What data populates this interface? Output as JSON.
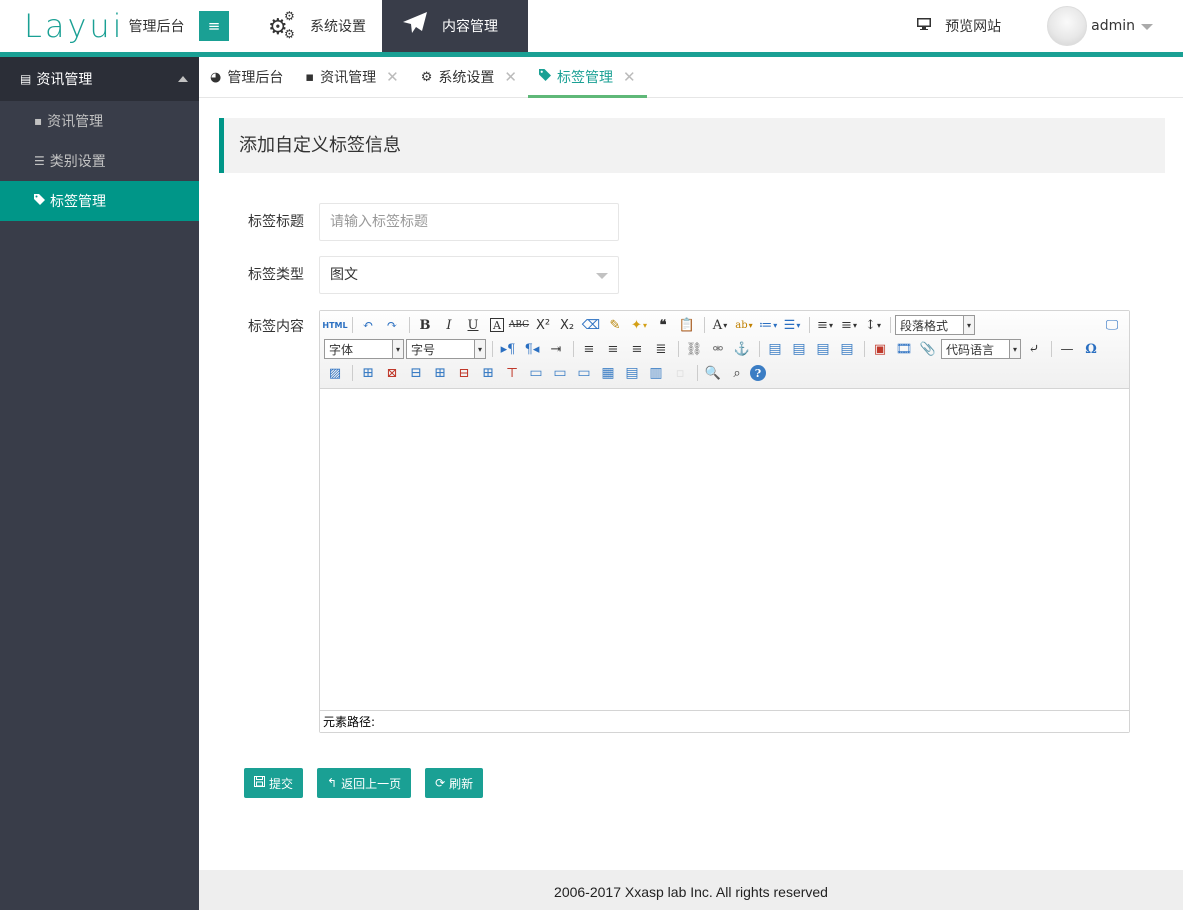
{
  "header": {
    "logo_main": "Layui",
    "logo_sub": "管理后台",
    "menu_toggle_icon": "≡",
    "nav": [
      {
        "label": "系统设置",
        "icon": "gears-icon"
      },
      {
        "label": "内容管理",
        "icon": "paper-plane-icon"
      }
    ],
    "preview_label": "预览网站",
    "user_name": "admin",
    "accent_color": "#1aa094"
  },
  "sidebar": {
    "group_label": "资讯管理",
    "items": [
      {
        "label": "资讯管理",
        "icon": "file-icon"
      },
      {
        "label": "类别设置",
        "icon": "list-icon"
      },
      {
        "label": "标签管理",
        "icon": "tag-icon"
      }
    ],
    "active_color": "#009688"
  },
  "tabs": [
    {
      "label": "管理后台",
      "icon": "dashboard-icon"
    },
    {
      "label": "资讯管理",
      "icon": "file-icon"
    },
    {
      "label": "系统设置",
      "icon": "gear-icon"
    },
    {
      "label": "标签管理",
      "icon": "tag-icon"
    }
  ],
  "page": {
    "title": "添加自定义标签信息",
    "form": {
      "title_label": "标签标题",
      "title_placeholder": "请输入标签标题",
      "type_label": "标签类型",
      "type_value": "图文",
      "content_label": "标签内容"
    },
    "editor": {
      "paragraph_format": "段落格式",
      "font_family": "字体",
      "font_size": "字号",
      "code_language": "代码语言",
      "status_label": "元素路径:"
    },
    "buttons": {
      "submit": "提交",
      "back": "返回上一页",
      "refresh": "刷新"
    }
  },
  "footer": {
    "text": "2006-2017 Xxasp lab Inc. All rights reserved"
  }
}
